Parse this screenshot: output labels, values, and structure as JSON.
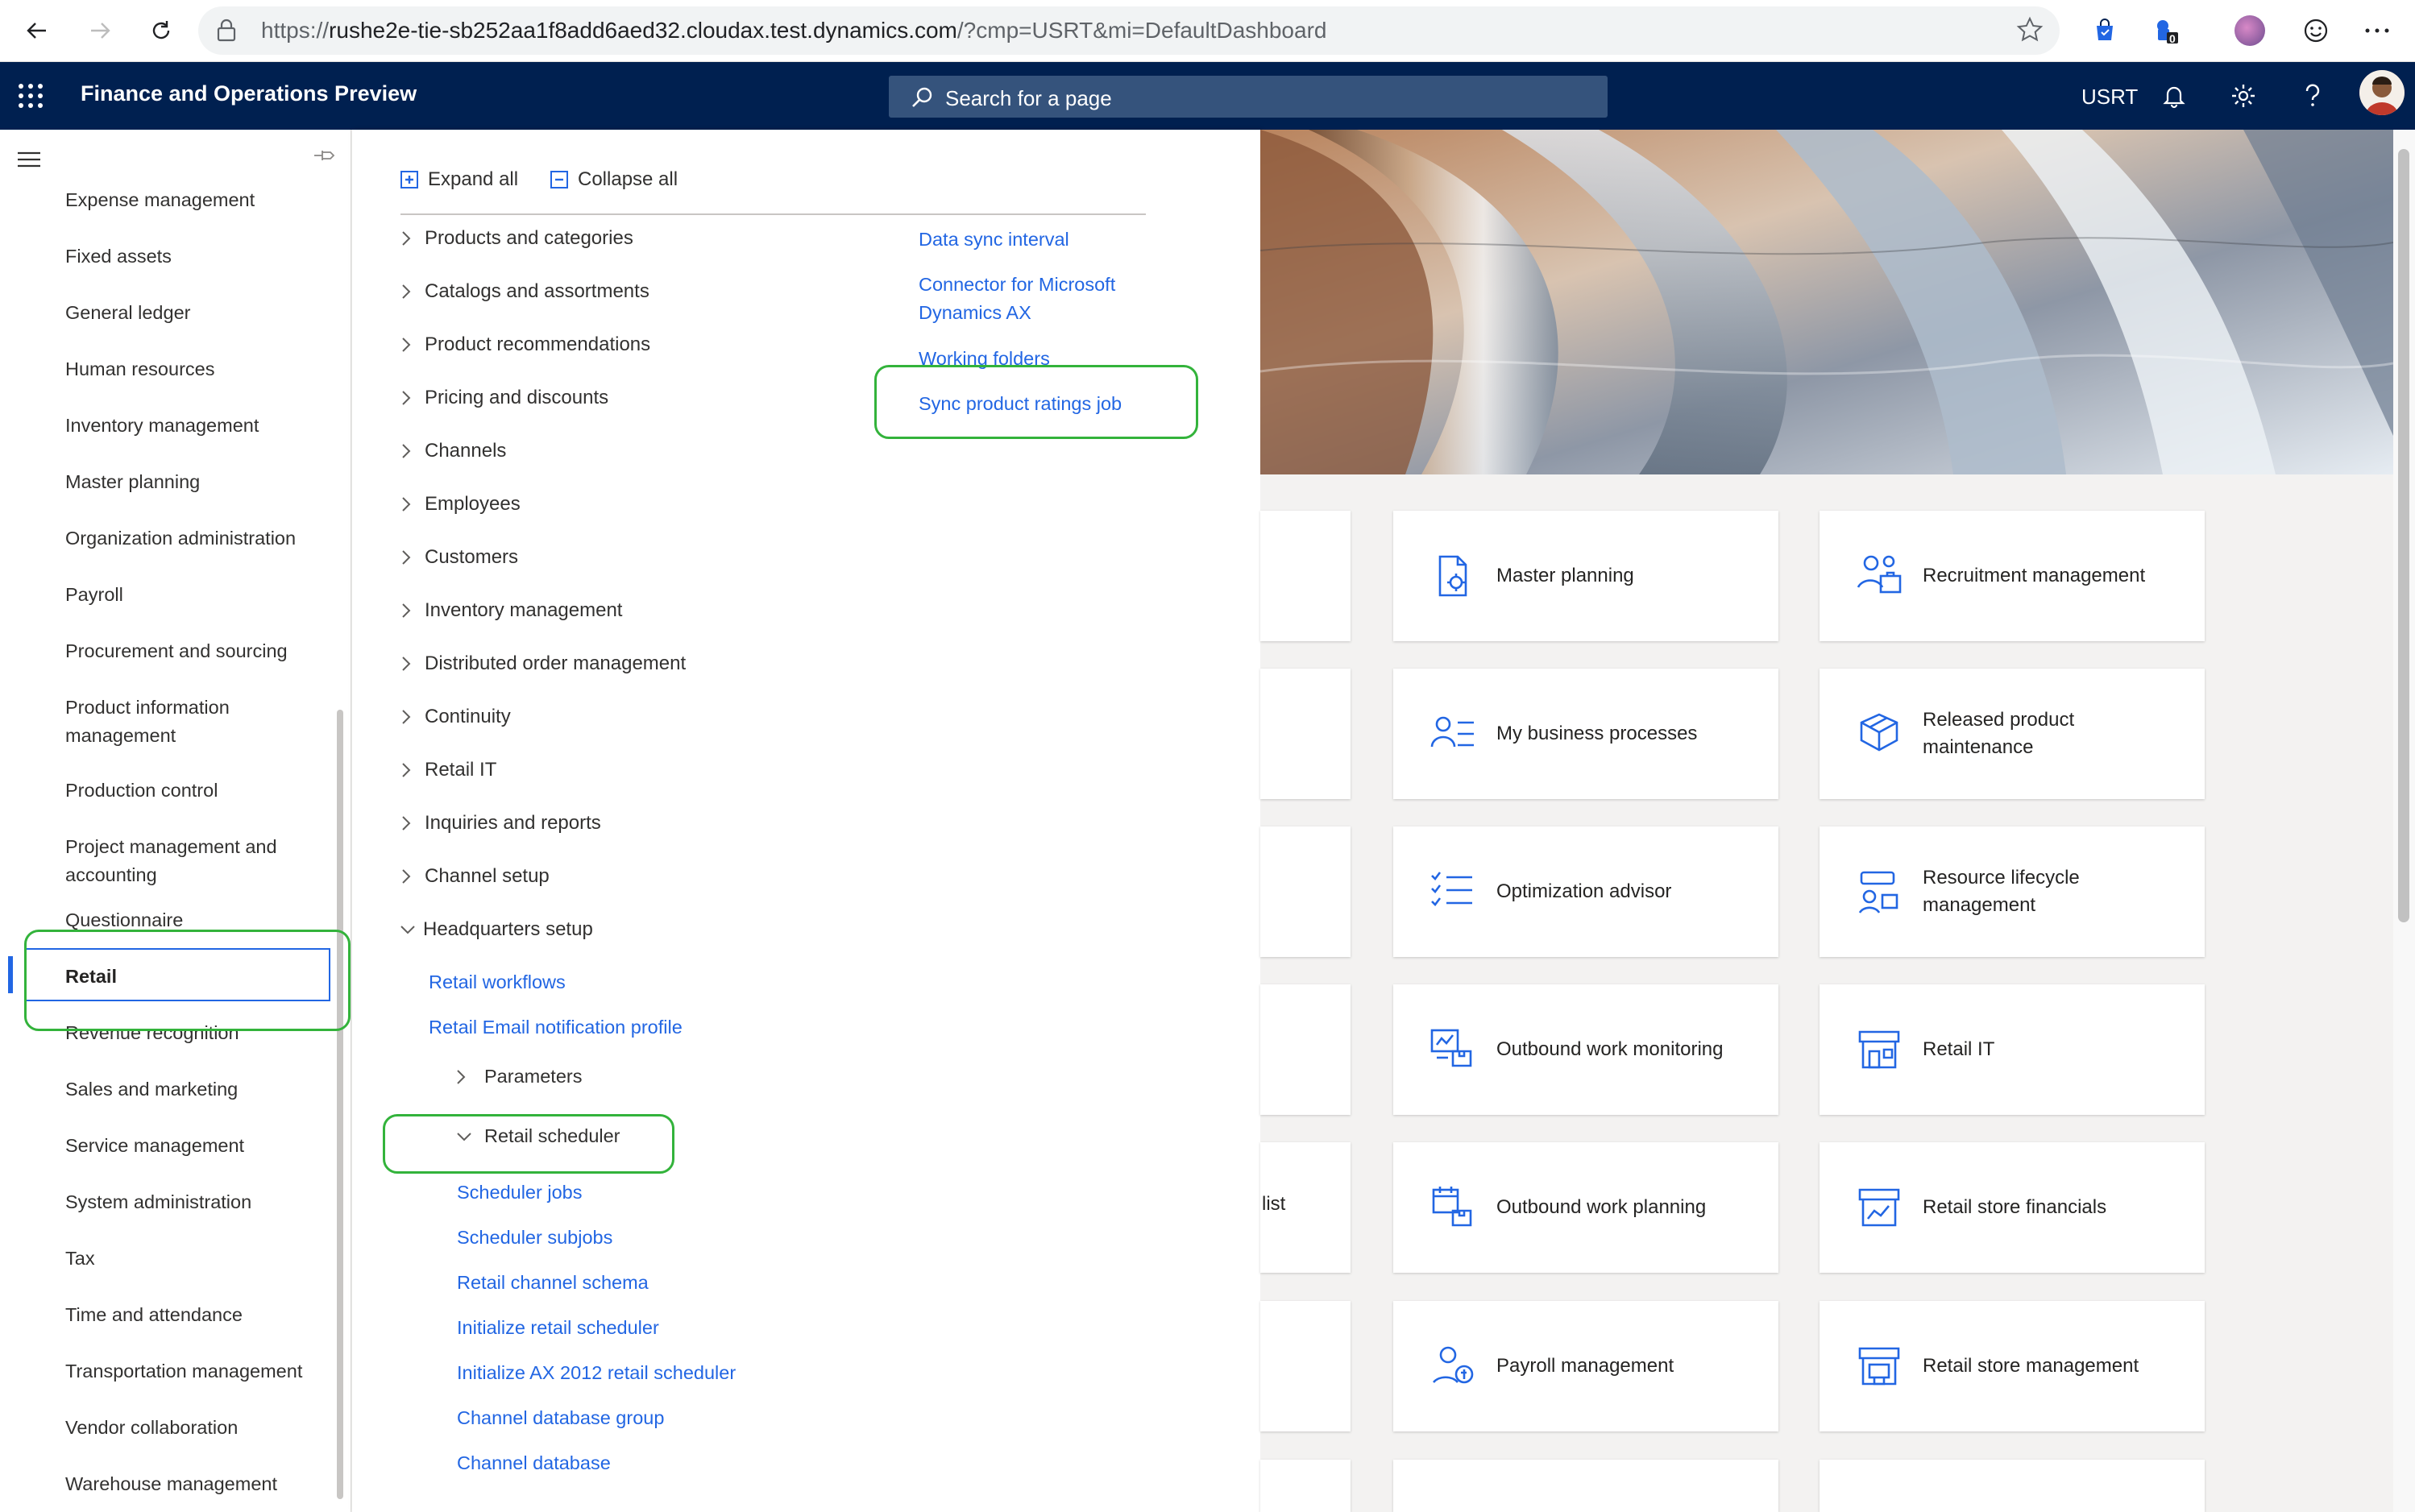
{
  "browser": {
    "url_scheme": "https://",
    "url_host": "rushe2e-tie-sb252aa1f8add6aed32.cloudax.test.dynamics.com",
    "url_path": "/?cmp=USRT&mi=DefaultDashboard",
    "ext_badge": "0"
  },
  "header": {
    "app_title": "Finance and Operations Preview",
    "search_placeholder": "Search for a page",
    "company": "USRT"
  },
  "left_nav": {
    "items": [
      "Expense management",
      "Fixed assets",
      "General ledger",
      "Human resources",
      "Inventory management",
      "Master planning",
      "Organization administration",
      "Payroll",
      "Procurement and sourcing",
      "Product information management",
      "Production control",
      "Project management and accounting",
      "Questionnaire",
      "Retail",
      "Revenue recognition",
      "Sales and marketing",
      "Service management",
      "System administration",
      "Tax",
      "Time and attendance",
      "Transportation management",
      "Vendor collaboration",
      "Warehouse management"
    ],
    "selected": "Retail"
  },
  "flyout": {
    "expand_all": "Expand all",
    "collapse_all": "Collapse all",
    "groups": [
      "Products and categories",
      "Catalogs and assortments",
      "Product recommendations",
      "Pricing and discounts",
      "Channels",
      "Employees",
      "Customers",
      "Inventory management",
      "Distributed order management",
      "Continuity",
      "Retail IT",
      "Inquiries and reports",
      "Channel setup",
      "Headquarters setup"
    ],
    "hq_links": [
      "Retail workflows",
      "Retail Email notification profile"
    ],
    "parameters": "Parameters",
    "retail_scheduler": "Retail scheduler",
    "scheduler_links": [
      "Scheduler jobs",
      "Scheduler subjobs",
      "Retail channel schema",
      "Initialize retail scheduler",
      "Initialize AX 2012 retail scheduler",
      "Channel database group",
      "Channel database"
    ],
    "right_links": [
      "Data sync interval",
      "Connector for Microsoft Dynamics AX",
      "Working folders",
      "Sync product ratings job"
    ]
  },
  "tiles": {
    "col1": [
      {
        "label": "Master planning",
        "icon": "master-planning-icon"
      },
      {
        "label": "My business processes",
        "icon": "business-processes-icon"
      },
      {
        "label": "Optimization advisor",
        "icon": "optimization-advisor-icon"
      },
      {
        "label": "Outbound work monitoring",
        "icon": "outbound-monitoring-icon"
      },
      {
        "label": "Outbound work planning",
        "icon": "outbound-planning-icon"
      },
      {
        "label": "Payroll management",
        "icon": "payroll-icon"
      }
    ],
    "col2": [
      {
        "label": "Recruitment management",
        "icon": "recruitment-icon"
      },
      {
        "label": "Released product maintenance",
        "icon": "released-product-icon"
      },
      {
        "label": "Resource lifecycle management",
        "icon": "resource-lifecycle-icon"
      },
      {
        "label": "Retail IT",
        "icon": "retail-it-icon"
      },
      {
        "label": "Retail store financials",
        "icon": "store-financials-icon"
      },
      {
        "label": "Retail store management",
        "icon": "store-management-icon"
      }
    ],
    "partial_label": "list"
  },
  "colors": {
    "header_bg": "#002050",
    "accent": "#2266e3",
    "highlight": "#33b33b",
    "tile_icon": "#2266e3"
  }
}
